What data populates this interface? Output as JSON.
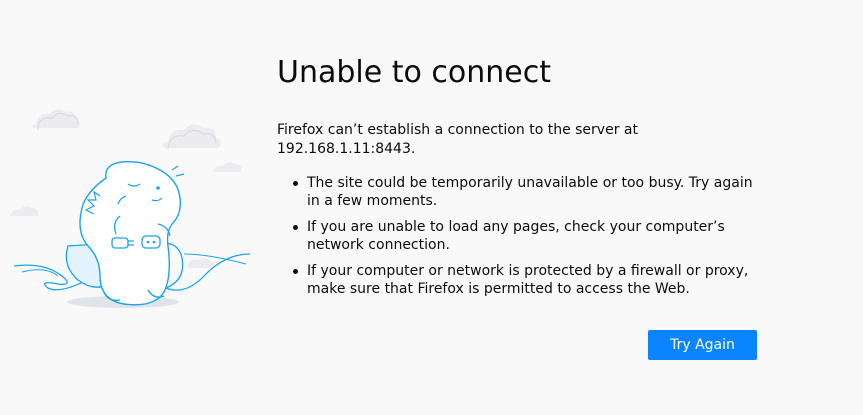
{
  "page": {
    "title": "Unable to connect",
    "description": "Firefox can’t establish a connection to the server at 192.168.1.11:8443.",
    "tips": [
      "The site could be temporarily unavailable or too busy. Try again in a few moments.",
      "If you are unable to load any pages, check your computer’s network connection.",
      "If your computer or network is protected by a firewall or proxy, make sure that Firefox is permitted to access the Web."
    ],
    "try_again_label": "Try Again"
  },
  "colors": {
    "accent": "#0a84ff",
    "background": "#f9f9fa",
    "text": "#0c0c0d",
    "illustration_stroke": "#1ba3e8",
    "cloud": "#e9e9ee"
  },
  "icons": {
    "illustration": "dino-unplugged-illustration"
  }
}
